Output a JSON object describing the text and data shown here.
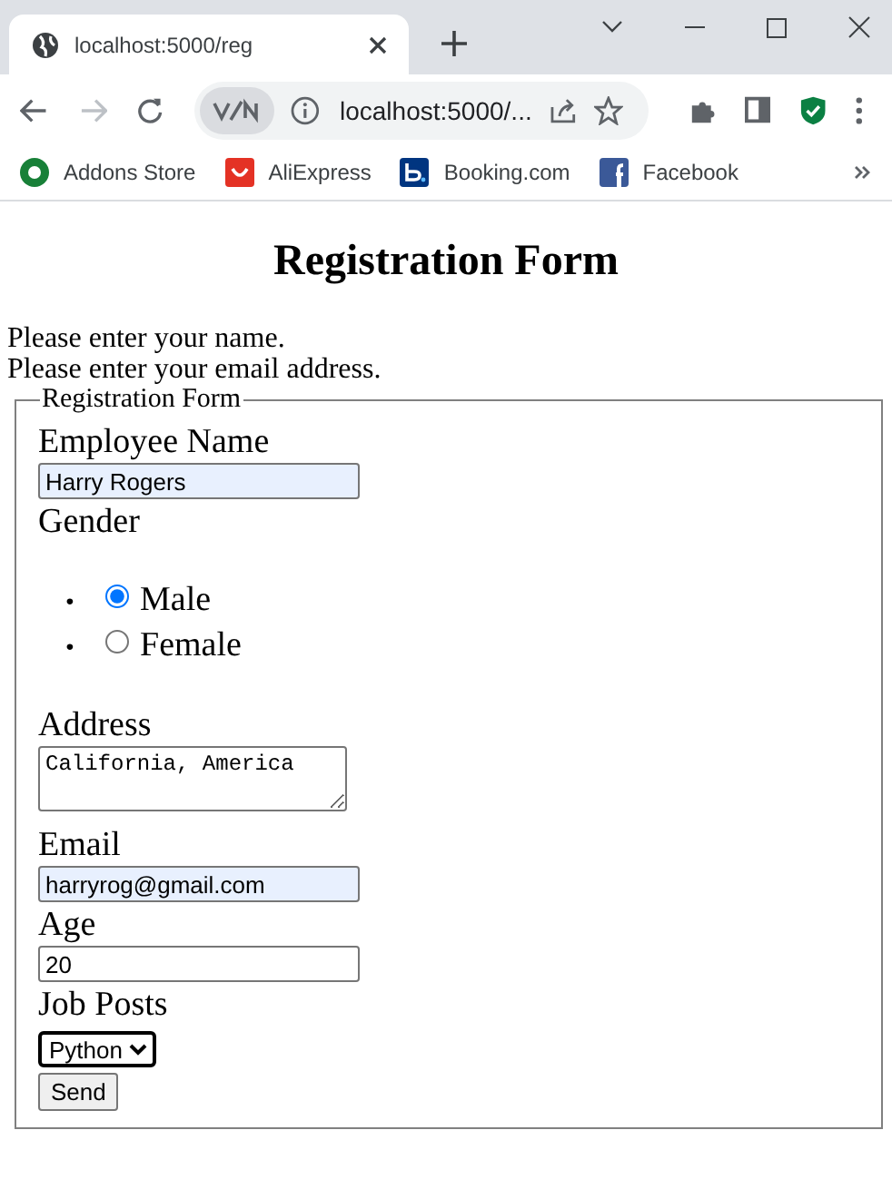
{
  "tab": {
    "title": "localhost:5000/reg"
  },
  "address_bar": {
    "url": "localhost:5000/..."
  },
  "bookmarks": [
    {
      "label": "Addons Store",
      "kind": "addons"
    },
    {
      "label": "AliExpress",
      "kind": "aliexpress"
    },
    {
      "label": "Booking.com",
      "kind": "booking"
    },
    {
      "label": "Facebook",
      "kind": "facebook"
    }
  ],
  "page": {
    "heading": "Registration Form",
    "messages": [
      "Please enter your name.",
      "Please enter your email address."
    ],
    "form": {
      "legend": "Registration Form",
      "fields": [
        {
          "kind": "text",
          "label": "Employee Name",
          "value": "Harry Rogers",
          "autofilled": true
        },
        {
          "kind": "radio",
          "label": "Gender",
          "options": [
            {
              "bullet": "•",
              "label": "Male",
              "selected": true
            },
            {
              "bullet": "•",
              "label": "Female",
              "selected": false
            }
          ]
        },
        {
          "kind": "textarea",
          "label": "Address",
          "value": "California, America"
        },
        {
          "kind": "text",
          "label": "Email",
          "value": "harryrog@gmail.com",
          "autofilled": true
        },
        {
          "kind": "text",
          "label": "Age",
          "value": "20",
          "autofilled": false
        },
        {
          "kind": "select",
          "label": "Job Posts",
          "value": "Python"
        }
      ],
      "submit": "Send"
    }
  }
}
